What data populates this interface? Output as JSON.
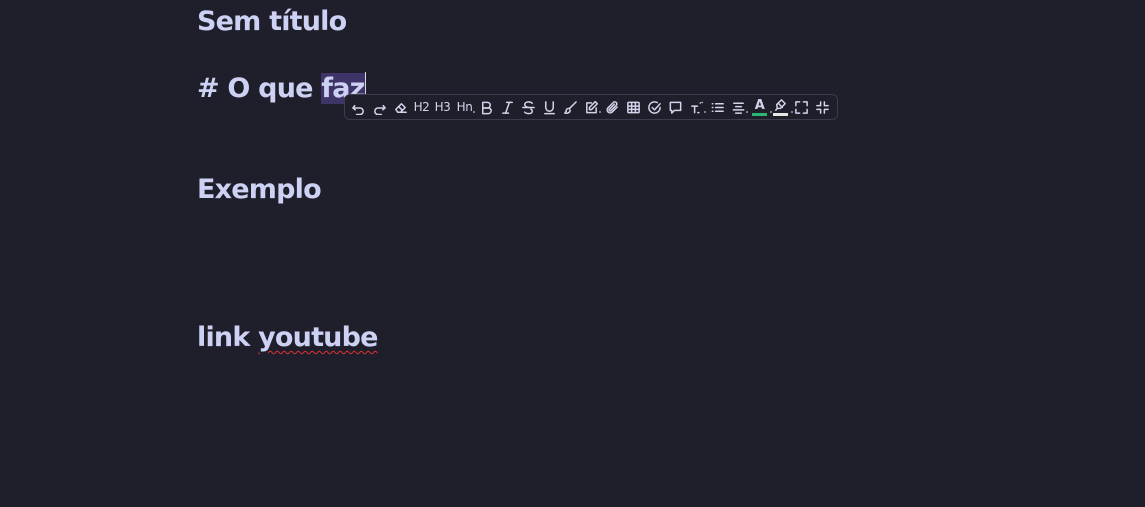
{
  "document": {
    "title": "Sem título",
    "heading_prefix": "# O que ",
    "heading_selected": "faz",
    "line_exemplo": "Exemplo",
    "link_prefix": "link ",
    "link_misspelled": "youtube"
  },
  "toolbar": {
    "h2_label": "H2",
    "h3_label": "H3",
    "hn_label": "Hn",
    "text_color_label": "A",
    "text_color": "#2bb673",
    "highlight_color": "#e6e6e6",
    "buttons": [
      "undo-icon",
      "redo-icon",
      "eraser-icon",
      "heading-2",
      "heading-3",
      "heading-n",
      "bold-icon",
      "italic-icon",
      "strikethrough-icon",
      "underline-icon",
      "brush-icon",
      "edit-icon",
      "attachment-icon",
      "table-icon",
      "checkbox-icon",
      "comment-icon",
      "superscript-icon",
      "list-icon",
      "align-icon",
      "text-color-icon",
      "highlight-icon",
      "fullscreen-icon",
      "exit-fullscreen-icon"
    ]
  }
}
